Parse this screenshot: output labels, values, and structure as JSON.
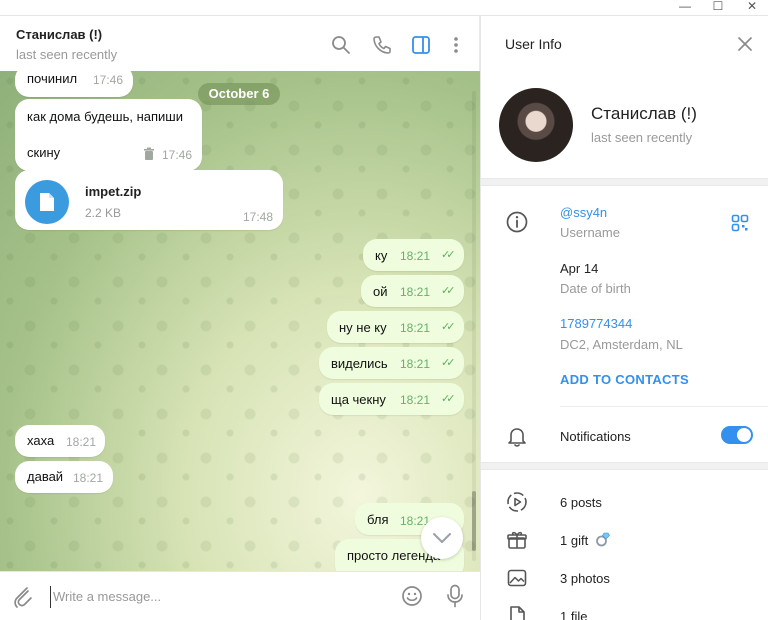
{
  "window": {
    "minimize": "—",
    "maximize": "☐",
    "close": "✕"
  },
  "chat": {
    "name": "Станислав (!)",
    "status": "last seen recently",
    "date_divider": "October 6",
    "messages": [
      {
        "text": "починил",
        "time": "17:46",
        "dir": "in"
      },
      {
        "text_line1": "как дома будешь, напиши",
        "text_line2": "скину",
        "time": "17:46",
        "dir": "in"
      },
      {
        "file_name": "impet.zip",
        "file_size": "2.2 KB",
        "time": "17:48",
        "dir": "in"
      },
      {
        "text": "ку",
        "time": "18:21",
        "dir": "out"
      },
      {
        "text": "ой",
        "time": "18:21",
        "dir": "out"
      },
      {
        "text": "ну не ку",
        "time": "18:21",
        "dir": "out"
      },
      {
        "text": "виделись",
        "time": "18:21",
        "dir": "out"
      },
      {
        "text": "ща чекну",
        "time": "18:21",
        "dir": "out"
      },
      {
        "text": "хаха",
        "time": "18:21",
        "dir": "in"
      },
      {
        "text": "давай",
        "time": "18:21",
        "dir": "in"
      },
      {
        "text": "бля",
        "time": "18:21",
        "dir": "out"
      },
      {
        "text": "просто легенда",
        "time": "",
        "dir": "out"
      }
    ],
    "composer_placeholder": "Write a message..."
  },
  "info": {
    "title": "User Info",
    "name": "Станислав (!)",
    "status": "last seen recently",
    "username": "@ssy4n",
    "username_label": "Username",
    "birth": "Apr 14",
    "birth_label": "Date of birth",
    "phone": "1789774344",
    "phone_label": "DC2, Amsterdam, NL",
    "add_contacts": "ADD TO CONTACTS",
    "notifications": "Notifications",
    "notifications_on": true,
    "media": {
      "posts": "6 posts",
      "gift": "1 gift",
      "photos": "3 photos",
      "file": "1 file"
    }
  },
  "colors": {
    "accent": "#3390ec",
    "outgoing": "#effdde",
    "ticks": "#5bb05f"
  }
}
